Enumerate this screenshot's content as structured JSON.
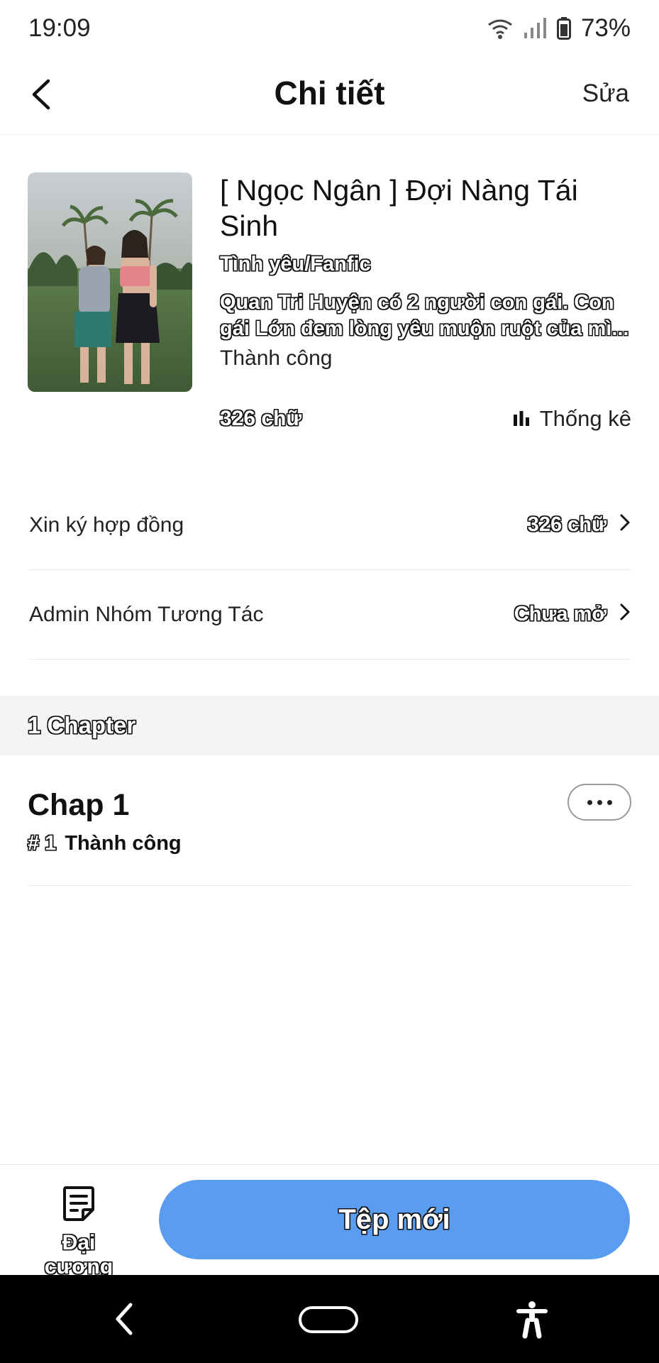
{
  "status_bar": {
    "time": "19:09",
    "battery": "73%"
  },
  "header": {
    "title": "Chi tiết",
    "edit_label": "Sửa"
  },
  "book": {
    "title": "[ Ngọc Ngân ] Đợi Nàng Tái Sinh",
    "genre": "Tình yêu/Fanfic",
    "description": "Quan Tri Huyện có 2 người con gái. Con gái Lớn đem lòng yêu muộn ruột của mì...",
    "status": "Thành công",
    "word_count": "326 chữ",
    "stats_label": "Thống kê"
  },
  "rows": [
    {
      "label": "Xin ký hợp đồng",
      "value": "326 chữ"
    },
    {
      "label": "Admin Nhóm Tương Tác",
      "value": "Chưa mở"
    }
  ],
  "chapters_section": {
    "header": "1 Chapter",
    "items": [
      {
        "name": "Chap 1",
        "number": "# 1",
        "status": "Thành công"
      }
    ]
  },
  "bottom_bar": {
    "outline_label": "Đại cương",
    "new_file_label": "Tệp mới"
  },
  "colors": {
    "primary_button": "#5a9df0",
    "section_bg": "#f4f4f4",
    "nav_bg": "#000000"
  }
}
